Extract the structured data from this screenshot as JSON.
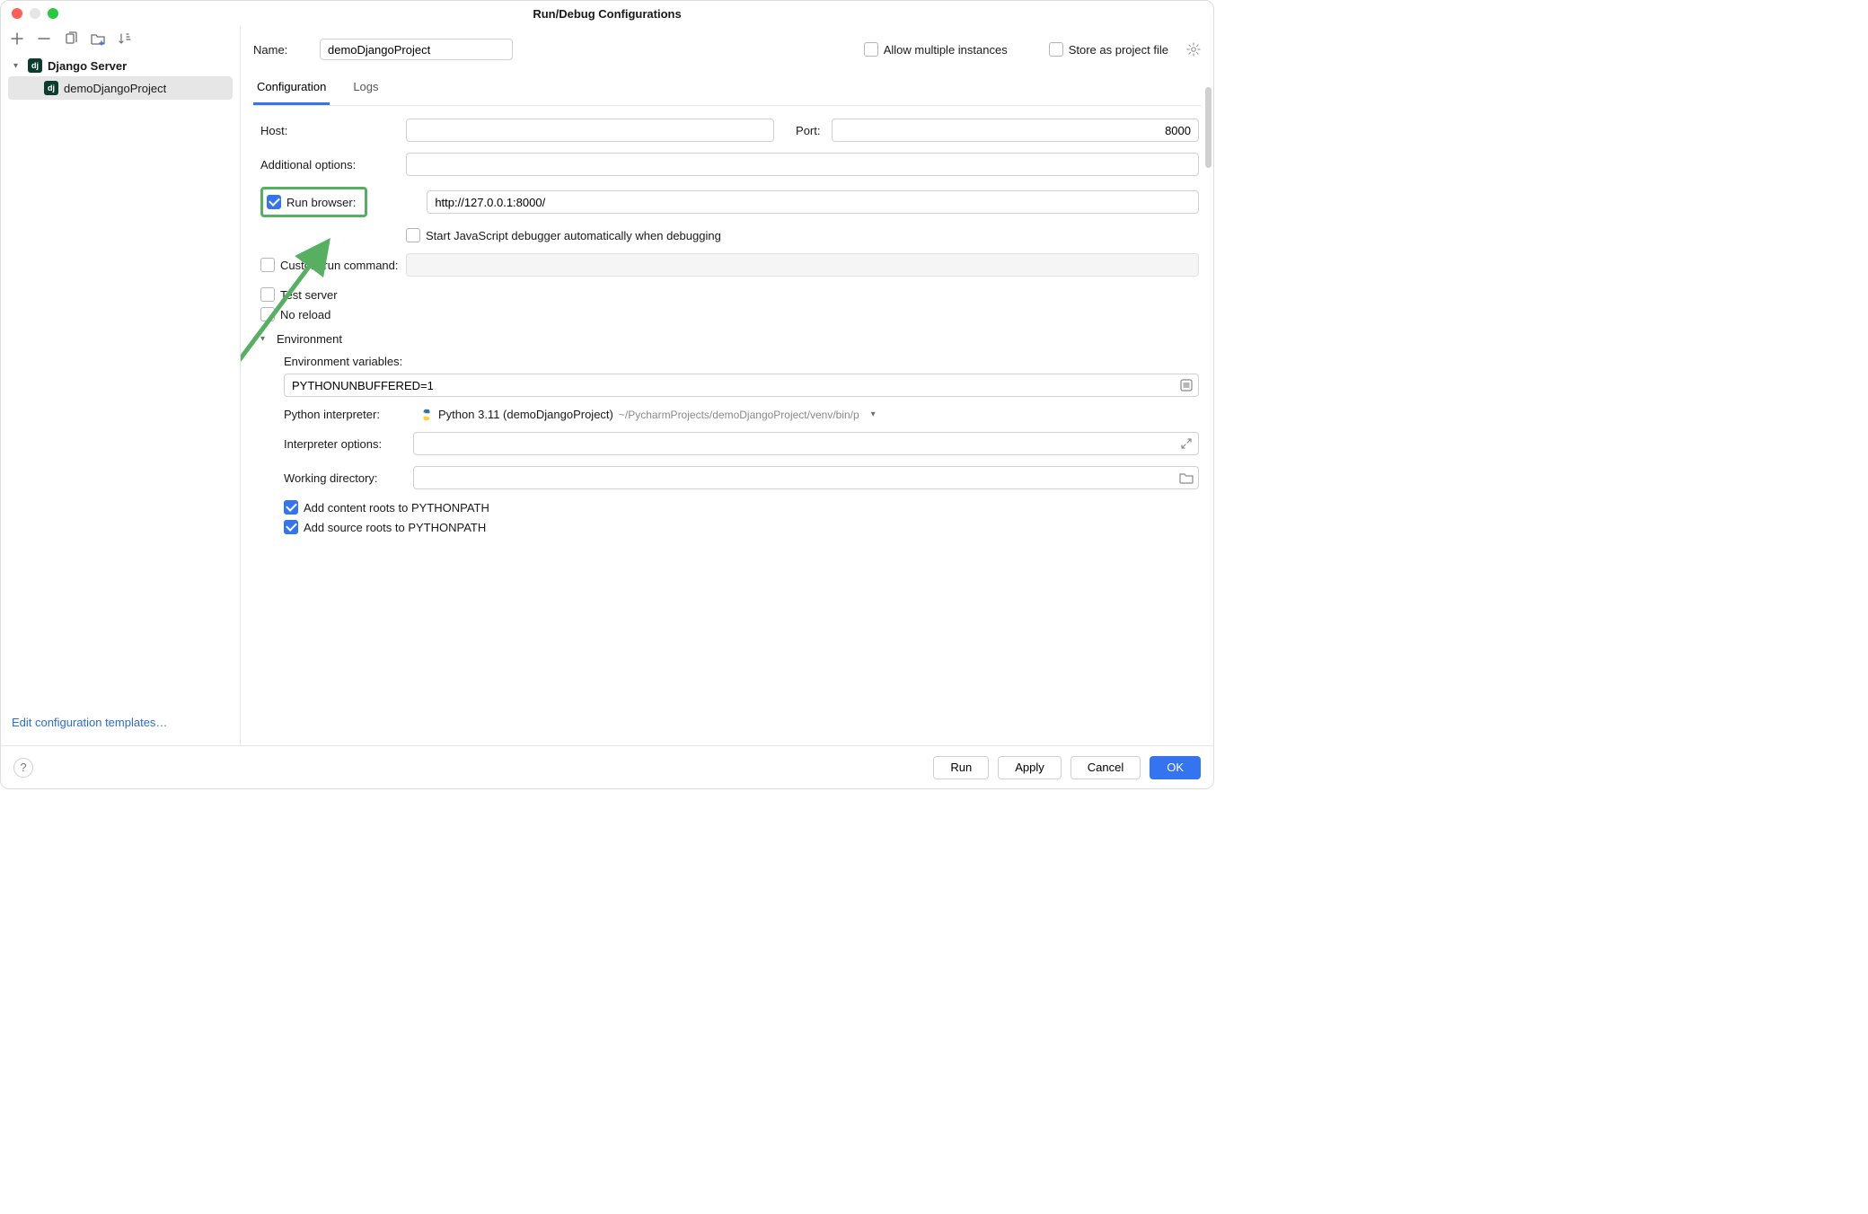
{
  "title": "Run/Debug Configurations",
  "left": {
    "group_label": "Django Server",
    "item_label": "demoDjangoProject",
    "edit_templates": "Edit configuration templates…"
  },
  "name_row": {
    "label": "Name:",
    "value": "demoDjangoProject",
    "allow_multiple": "Allow multiple instances",
    "store_as": "Store as project file"
  },
  "tabs": {
    "configuration": "Configuration",
    "logs": "Logs"
  },
  "config": {
    "host_label": "Host:",
    "host_value": "",
    "port_label": "Port:",
    "port_value": "8000",
    "addl_label": "Additional options:",
    "addl_value": "",
    "run_browser_label": "Run browser:",
    "run_browser_url": "http://127.0.0.1:8000/",
    "start_js_debugger": "Start JavaScript debugger automatically when debugging",
    "custom_run_label": "Custom run command:",
    "test_server": "Test server",
    "no_reload": "No reload"
  },
  "env": {
    "header": "Environment",
    "env_vars_label": "Environment variables:",
    "env_vars_value": "PYTHONUNBUFFERED=1",
    "interpreter_label": "Python interpreter:",
    "interpreter_name": "Python 3.11 (demoDjangoProject)",
    "interpreter_path": "~/PycharmProjects/demoDjangoProject/venv/bin/p",
    "interpreter_opts_label": "Interpreter options:",
    "interpreter_opts_value": "",
    "working_dir_label": "Working directory:",
    "working_dir_value": "",
    "add_content_roots": "Add content roots to PYTHONPATH",
    "add_source_roots": "Add source roots to PYTHONPATH"
  },
  "footer": {
    "run": "Run",
    "apply": "Apply",
    "cancel": "Cancel",
    "ok": "OK"
  }
}
